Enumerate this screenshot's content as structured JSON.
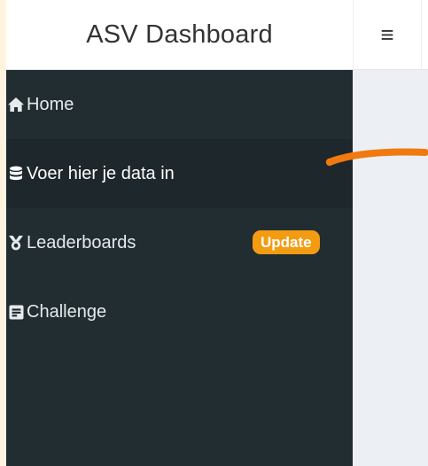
{
  "header": {
    "brand": "ASV Dashboard",
    "toggle_icon": "≡"
  },
  "sidebar": {
    "items": [
      {
        "label": "Home",
        "icon": "home-icon"
      },
      {
        "label": "Voer hier je data in",
        "icon": "database-icon",
        "active": true
      },
      {
        "label": "Leaderboards",
        "icon": "medal-icon",
        "badge": "Update"
      },
      {
        "label": "Challenge",
        "icon": "list-icon"
      }
    ]
  },
  "colors": {
    "page_background": "#fff3e0",
    "sidebar": "#222d32",
    "sidebar_active": "#1e282c",
    "content": "#ecf0f5",
    "badge": "#f39c12",
    "arrow": "#f07a10"
  }
}
